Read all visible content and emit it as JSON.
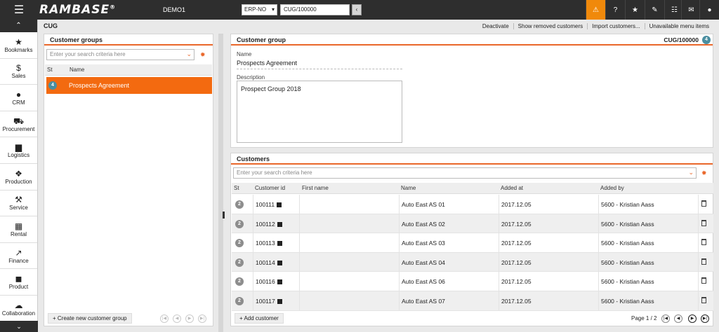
{
  "topbar": {
    "menu_icon": "hamburger-icon",
    "logo": "RAMBASE",
    "logo_mark": "®",
    "company": "DEMO1",
    "system": "ERP-NO",
    "object_id": "CUG/100000",
    "back_glyph": "‹",
    "buttons": [
      "warning-icon",
      "help-icon",
      "star-icon",
      "paperclip-icon",
      "list-icon",
      "mail-icon",
      "user-icon"
    ],
    "accent": "#f0890b"
  },
  "nav": {
    "items": [
      {
        "label": "Bookmarks",
        "icon": "star-icon"
      },
      {
        "label": "Sales",
        "icon": "money-bag-icon"
      },
      {
        "label": "CRM",
        "icon": "people-icon"
      },
      {
        "label": "Procurement",
        "icon": "cart-icon"
      },
      {
        "label": "Logistics",
        "icon": "truck-icon"
      },
      {
        "label": "Production",
        "icon": "cubes-icon"
      },
      {
        "label": "Service",
        "icon": "wrench-icon"
      },
      {
        "label": "Rental",
        "icon": "calendar-icon"
      },
      {
        "label": "Finance",
        "icon": "chart-line-icon"
      },
      {
        "label": "Product",
        "icon": "box-icon"
      },
      {
        "label": "Collaboration",
        "icon": "chat-icon"
      }
    ]
  },
  "page": {
    "title": "CUG",
    "menu": [
      "Deactivate",
      "Show removed customers",
      "Import customers...",
      "Unavailable menu items"
    ]
  },
  "groups": {
    "title": "Customer groups",
    "search_placeholder": "Enter your search criteria here",
    "columns": [
      "St",
      "Name"
    ],
    "rows": [
      {
        "status": "4",
        "name": "Prospects Agreement"
      }
    ],
    "create_label": "Create new customer group",
    "highlight": "#f36a10"
  },
  "group": {
    "title": "Customer group",
    "id": "CUG/100000",
    "status": "4",
    "name_label": "Name",
    "name_value": "Prospects Agreement",
    "desc_label": "Description",
    "desc_value": "Prospect Group 2018"
  },
  "customers": {
    "title": "Customers",
    "search_placeholder": "Enter your search criteria here",
    "columns": [
      "St",
      "Customer id",
      "First name",
      "Name",
      "Added at",
      "Added by"
    ],
    "rows": [
      {
        "status": "2",
        "id": "100111",
        "first": "",
        "name": "Auto East AS 01",
        "added_at": "2017.12.05",
        "added_by": "5600 - Kristian Aass"
      },
      {
        "status": "2",
        "id": "100112",
        "first": "",
        "name": "Auto East AS 02",
        "added_at": "2017.12.05",
        "added_by": "5600 - Kristian Aass"
      },
      {
        "status": "2",
        "id": "100113",
        "first": "",
        "name": "Auto East AS 03",
        "added_at": "2017.12.05",
        "added_by": "5600 - Kristian Aass"
      },
      {
        "status": "2",
        "id": "100114",
        "first": "",
        "name": "Auto East AS 04",
        "added_at": "2017.12.05",
        "added_by": "5600 - Kristian Aass"
      },
      {
        "status": "2",
        "id": "100116",
        "first": "",
        "name": "Auto East AS 06",
        "added_at": "2017.12.05",
        "added_by": "5600 - Kristian Aass"
      },
      {
        "status": "2",
        "id": "100117",
        "first": "",
        "name": "Auto East AS 07",
        "added_at": "2017.12.05",
        "added_by": "5600 - Kristian Aass"
      }
    ],
    "add_label": "Add customer",
    "page_info": "Page 1 / 2"
  }
}
